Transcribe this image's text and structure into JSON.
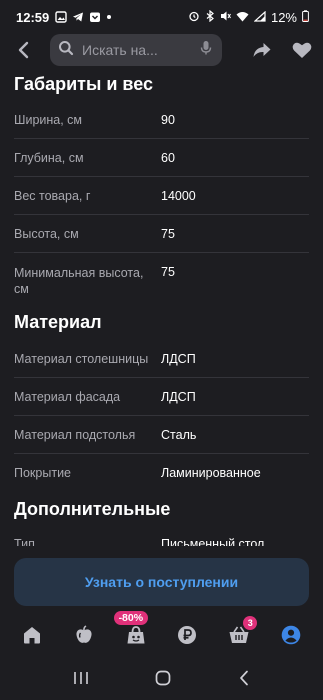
{
  "status_bar": {
    "time": "12:59",
    "battery": "12%"
  },
  "header": {
    "search_placeholder": "Искать на..."
  },
  "sections": [
    {
      "title": "Габариты и вес",
      "rows": [
        {
          "key": "Ширина, см",
          "value": "90"
        },
        {
          "key": "Глубина, см",
          "value": "60"
        },
        {
          "key": "Вес товара, г",
          "value": "14000"
        },
        {
          "key": "Высота, см",
          "value": "75"
        },
        {
          "key": "Минимальная высота, см",
          "value": "75"
        }
      ]
    },
    {
      "title": "Материал",
      "rows": [
        {
          "key": "Материал столешницы",
          "value": "ЛДСП"
        },
        {
          "key": "Материал фасада",
          "value": "ЛДСП"
        },
        {
          "key": "Материал подстолья",
          "value": "Сталь"
        },
        {
          "key": "Покрытие",
          "value": "Ламинированное"
        }
      ]
    },
    {
      "title": "Дополнительные",
      "rows": [
        {
          "key": "Тип",
          "value": "Письменный стол"
        }
      ]
    }
  ],
  "cta": {
    "label": "Узнать о поступлении"
  },
  "bottom_nav": {
    "sale_badge": "-80%",
    "cart_count": "3",
    "items": [
      "home-icon",
      "fruit-icon",
      "sale-bag-icon",
      "ruble-icon",
      "cart-icon",
      "profile-icon"
    ]
  },
  "colors": {
    "background": "#1d1d21",
    "accent": "#4f9ef0",
    "badge": "#e0317a",
    "active_nav": "#3d86e6"
  }
}
